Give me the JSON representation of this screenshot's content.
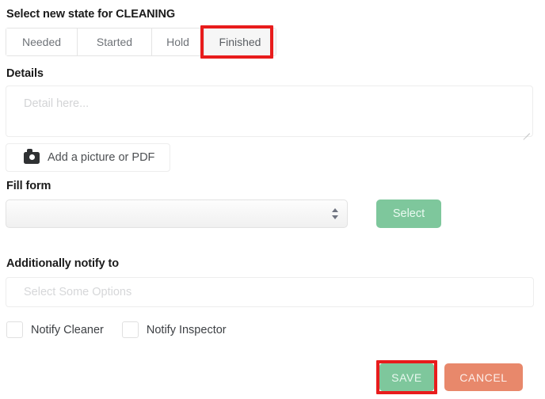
{
  "dialog": {
    "title": "Select new state for CLEANING",
    "state_tabs": [
      {
        "label": "Needed",
        "selected": false
      },
      {
        "label": "Started",
        "selected": false
      },
      {
        "label": "Hold",
        "selected": false
      },
      {
        "label": "Finished",
        "selected": true
      }
    ],
    "details": {
      "label": "Details",
      "value": "",
      "placeholder": "Detail here..."
    },
    "attachment": {
      "button_label": "Add a picture or PDF",
      "icon": "camera-icon"
    },
    "fill_form": {
      "label": "Fill form",
      "select_value": "",
      "select_button_label": "Select",
      "spinner_icon": "up-down-stepper-icon"
    },
    "notify": {
      "label": "Additionally notify to",
      "value": "",
      "placeholder": "Select Some Options",
      "checkboxes": [
        {
          "label": "Notify Cleaner",
          "checked": false
        },
        {
          "label": "Notify Inspector",
          "checked": false
        }
      ]
    },
    "actions": {
      "save_label": "SAVE",
      "cancel_label": "CANCEL"
    },
    "annotations": {
      "highlight_color": "#e81c1c",
      "highlighted_elements": [
        "Finished",
        "SAVE"
      ]
    },
    "colors": {
      "primary_green": "#7ec79c",
      "cancel_salmon": "#e8886b",
      "text_dark": "#1b1b1b",
      "text_muted": "#6f7378",
      "placeholder": "#d3d4d6",
      "border": "#ededed"
    }
  }
}
